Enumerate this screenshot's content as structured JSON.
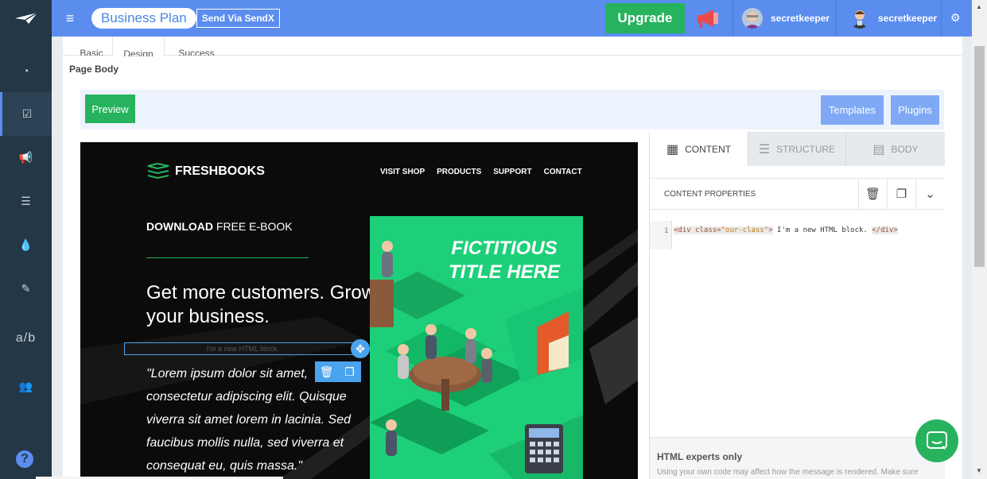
{
  "topbar": {
    "plan_label": "Business Plan",
    "send_label": "Send Via SendX",
    "upgrade_label": "Upgrade",
    "users": [
      {
        "name": "secretkeeper"
      },
      {
        "name": "secretkeeper"
      }
    ]
  },
  "sidebar": {
    "ab_label": "a/b",
    "help_label": "?"
  },
  "tabs": [
    {
      "label": "Basic"
    },
    {
      "label": "Design"
    },
    {
      "label": "Success"
    }
  ],
  "page_body_label": "Page Body",
  "toolbar": {
    "preview_label": "Preview",
    "templates_label": "Templates",
    "plugins_label": "Plugins"
  },
  "email": {
    "logo_text": "FRESHBOOKS",
    "nav": [
      "VISIT SHOP",
      "PRODUCTS",
      "SUPPORT",
      "CONTACT"
    ],
    "download_bold": "DOWNLOAD",
    "download_rest": " FREE E-BOOK",
    "headline": "Get more customers. Grow your business.",
    "html_block_placeholder": "I'm a new HTML block",
    "quote": "\"Lorem ipsum dolor sit amet, consectetur adipiscing elit. Quisque viverra sit amet lorem in lacinia. Sed faucibus mollis nulla, sed viverra et consequat eu,  quis massa.\"",
    "ebook_title": "FICTITIOUS TITLE HERE"
  },
  "panel": {
    "tabs": [
      {
        "label": "CONTENT"
      },
      {
        "label": "STRUCTURE"
      },
      {
        "label": "BODY"
      }
    ],
    "props_label": "CONTENT PROPERTIES",
    "code": {
      "line_number": "1",
      "open_tag": "<div class=",
      "class_value": "\"our-class\"",
      "close_open": ">",
      "text": " I'm a new HTML block. ",
      "close_tag": "</div>"
    },
    "footer_title": "HTML experts only",
    "footer_text": "Using your own code may affect how the message is rendered. Make sure"
  },
  "colors": {
    "topbar": "#5b8def",
    "sidebar": "#243746",
    "green": "#27b35e",
    "ebook": "#1ecf7a"
  }
}
